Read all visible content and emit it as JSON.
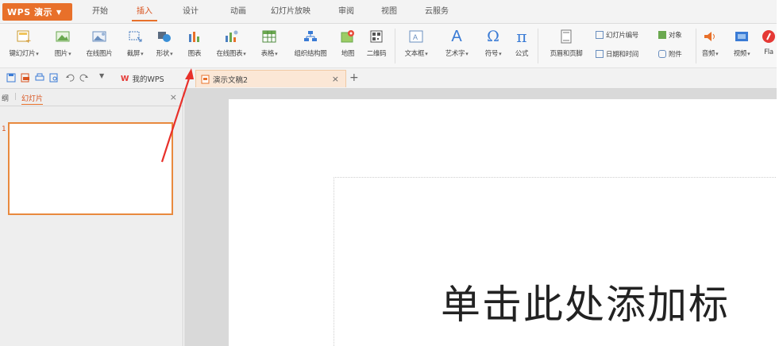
{
  "app": {
    "button_label": "WPS 演示"
  },
  "menu": {
    "tabs": [
      {
        "label": "开始"
      },
      {
        "label": "插入"
      },
      {
        "label": "设计"
      },
      {
        "label": "动画"
      },
      {
        "label": "幻灯片放映"
      },
      {
        "label": "审阅"
      },
      {
        "label": "视图"
      },
      {
        "label": "云服务"
      }
    ],
    "active": "插入"
  },
  "ribbon": {
    "items": [
      {
        "label": "键幻灯片",
        "icon": "new-slide-icon",
        "dropdown": true
      },
      {
        "label": "图片",
        "icon": "picture-icon",
        "dropdown": true
      },
      {
        "label": "在线图片",
        "icon": "online-picture-icon",
        "dropdown": false
      },
      {
        "label": "截屏",
        "icon": "screenshot-icon",
        "dropdown": true
      },
      {
        "label": "形状",
        "icon": "shapes-icon",
        "dropdown": true
      },
      {
        "label": "图表",
        "icon": "chart-icon",
        "dropdown": false
      },
      {
        "label": "在线图表",
        "icon": "online-chart-icon",
        "dropdown": true
      },
      {
        "label": "表格",
        "icon": "table-icon",
        "dropdown": true
      },
      {
        "label": "组织结构图",
        "icon": "org-chart-icon",
        "dropdown": false
      },
      {
        "label": "地图",
        "icon": "map-icon",
        "dropdown": false
      },
      {
        "label": "二维码",
        "icon": "qrcode-icon",
        "dropdown": false
      },
      {
        "label": "文本框",
        "icon": "textbox-icon",
        "dropdown": true
      },
      {
        "label": "艺术字",
        "icon": "wordart-icon",
        "dropdown": true
      },
      {
        "label": "符号",
        "icon": "omega-icon",
        "dropdown": true
      },
      {
        "label": "公式",
        "icon": "pi-icon",
        "dropdown": false
      },
      {
        "label": "页眉和页脚",
        "icon": "header-footer-icon",
        "dropdown": false
      },
      {
        "label": "音频",
        "icon": "audio-icon",
        "dropdown": true
      },
      {
        "label": "视频",
        "icon": "video-icon",
        "dropdown": true
      },
      {
        "label": "Fla",
        "icon": "flash-icon",
        "dropdown": false
      }
    ],
    "small_items": {
      "slide_number": "幻灯片编号",
      "object": "对象",
      "date_time": "日期和时间",
      "attachment": "附件"
    },
    "symbols": {
      "wordart_glyph": "A",
      "omega_glyph": "Ω",
      "pi_glyph": "π"
    }
  },
  "doc_tabs": {
    "home": "我的WPS",
    "home_logo": "W",
    "active": "演示文稿2",
    "close_glyph": "×",
    "add_glyph": "+"
  },
  "left_panel": {
    "tabs": [
      "纲",
      "幻灯片"
    ],
    "slide_number": "1",
    "close_glyph": "×"
  },
  "canvas": {
    "title_placeholder": "单击此处添加标",
    "watermark": "ⓓ"
  },
  "colors": {
    "accent": "#e8702a",
    "annotation_arrow": "#e8302a"
  }
}
